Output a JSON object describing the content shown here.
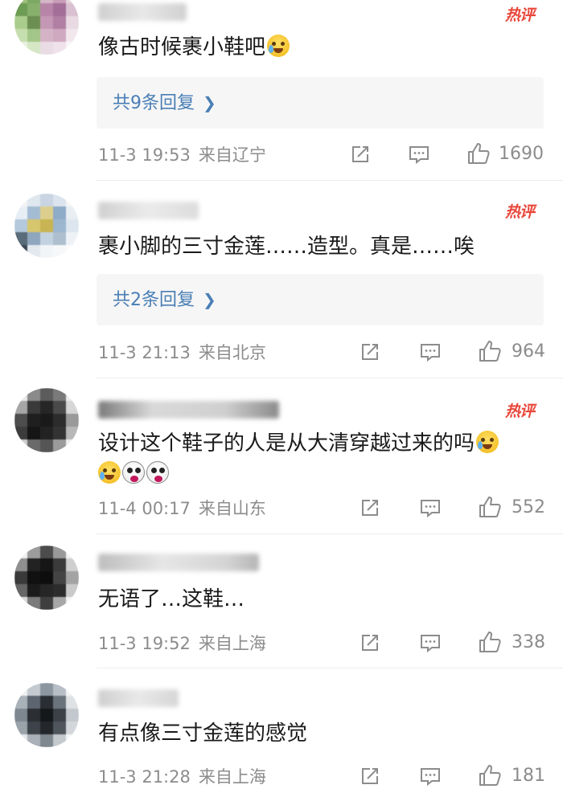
{
  "comments": [
    {
      "hot_badge": "热评",
      "text": "像古时候裹小鞋吧",
      "reply_link": "共9条回复",
      "time": "11-3 19:53",
      "location": "来自辽宁",
      "likes": "1690"
    },
    {
      "hot_badge": "热评",
      "text": "裹小脚的三寸金莲……造型。真是……唉",
      "reply_link": "共2条回复",
      "time": "11-3 21:13",
      "location": "来自北京",
      "likes": "964"
    },
    {
      "hot_badge": "热评",
      "text": "设计这个鞋子的人是从大清穿越过来的吗",
      "time": "11-4 00:17",
      "location": "来自山东",
      "likes": "552"
    },
    {
      "text": "无语了…这鞋…",
      "time": "11-3 19:52",
      "location": "来自上海",
      "likes": "338"
    },
    {
      "text": "有点像三寸金莲的感觉",
      "time": "11-3 21:28",
      "location": "来自上海",
      "likes": "181"
    }
  ],
  "icons": {
    "share": "share-edit-icon",
    "reply": "comment-icon",
    "like": "thumbs-up-icon",
    "chevron": "chevron-right-icon",
    "emoji_cry": "crying-laughing-emoji-icon",
    "emoji_scared": "scared-face-emoji-icon"
  },
  "colors": {
    "hot_badge": "#e8473b",
    "reply_link": "#4a7fb5",
    "meta": "#8c8c8c",
    "reply_box_bg": "#f6f6f6"
  }
}
